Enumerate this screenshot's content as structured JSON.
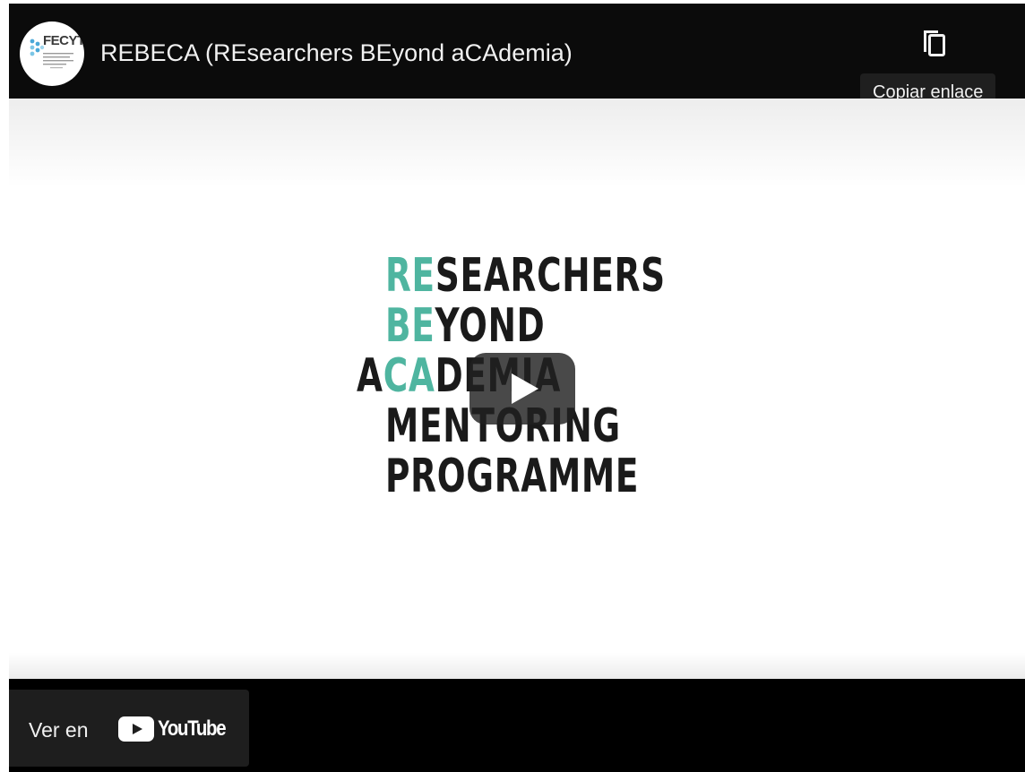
{
  "header": {
    "channel_logo_text": "FECYT",
    "title": "REBECA (REsearchers BEyond aCAdemia)",
    "copy_link_icon": "copy-icon",
    "copy_link_tooltip": "Copiar enlace"
  },
  "thumbnail": {
    "lines": [
      {
        "accent": "RE",
        "rest": "SEARCHERS"
      },
      {
        "accent": "BE",
        "rest": "YOND"
      },
      {
        "lead": "A",
        "accent": "CA",
        "rest": "DEMIA"
      },
      {
        "rest": "MENTORING"
      },
      {
        "rest": "PROGRAMME"
      }
    ],
    "accent_color": "#4fb5a0",
    "play_icon": "play-icon"
  },
  "footer": {
    "watch_on_label": "Ver en",
    "youtube_word": "YouTube",
    "youtube_icon": "youtube-logo-icon"
  }
}
